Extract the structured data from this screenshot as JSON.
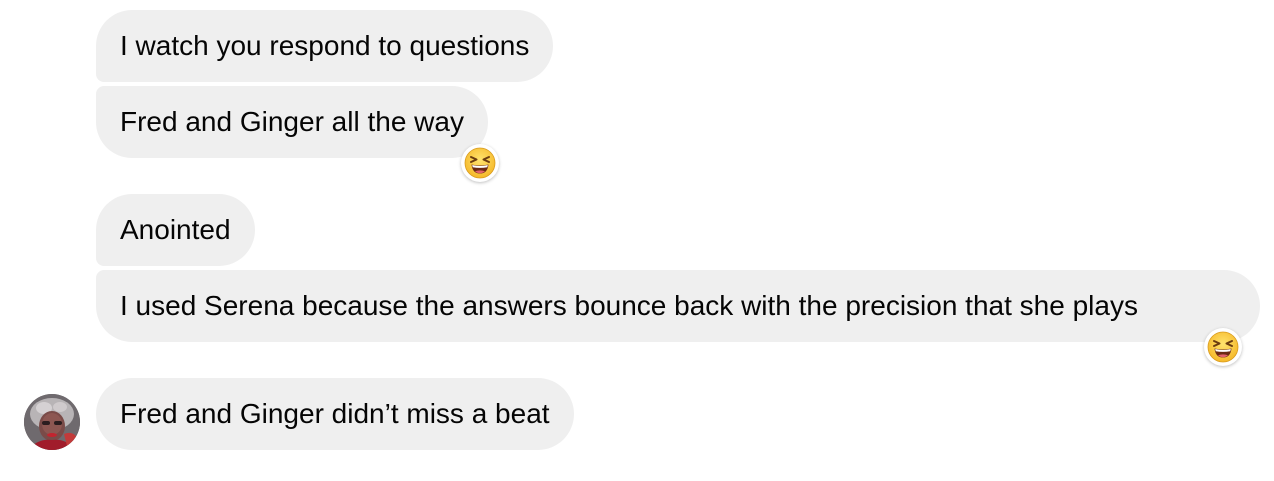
{
  "messages": [
    {
      "text": "I watch you respond to questions",
      "reaction": null
    },
    {
      "text": "Fred and Ginger all the way",
      "reaction": "laughing-squint-emoji"
    },
    {
      "text": "Anointed",
      "reaction": null
    },
    {
      "text": "I used Serena because the answers bounce back with the precision that she plays",
      "reaction": "laughing-squint-emoji"
    },
    {
      "text": "Fred and Ginger didn’t miss a beat",
      "reaction": null
    }
  ],
  "colors": {
    "bubble_bg": "#efefef",
    "text": "#050505",
    "background": "#ffffff"
  },
  "icons": {
    "reaction": "laughing-squint-emoji",
    "sender": "avatar"
  }
}
